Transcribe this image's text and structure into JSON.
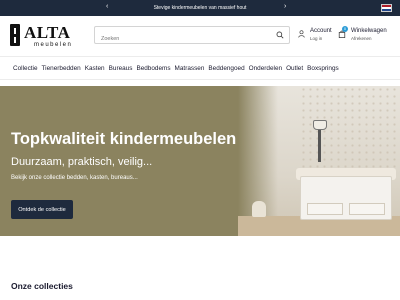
{
  "topbar": {
    "promo": "Stevige kindermeubelen van massief hout",
    "flag": "nl-flag"
  },
  "header": {
    "logo_name": "ALTA",
    "logo_sub": "meubelen",
    "search_placeholder": "Zoeken",
    "account_label": "Account",
    "account_sub": "Log in",
    "cart_label": "Winkelwagen",
    "cart_sub": "Afrekenen",
    "cart_count": "0"
  },
  "nav": {
    "items": [
      "Collectie",
      "Tienerbedden",
      "Kasten",
      "Bureaus",
      "Bedbodems",
      "Matrassen",
      "Beddengoed",
      "Onderdelen",
      "Outlet",
      "Boxsprings"
    ]
  },
  "hero": {
    "title": "Topkwaliteit kindermeubelen",
    "subtitle": "Duurzaam, praktisch, veilig...",
    "text": "Bekijk onze collectie bedden, kasten, bureaus...",
    "cta": "Ontdek de collectie"
  },
  "section": {
    "title": "Onze collecties"
  },
  "colors": {
    "dark_navy": "#1e2a3d",
    "hero_olive": "#8b835f",
    "badge_blue": "#2a9bd6"
  }
}
